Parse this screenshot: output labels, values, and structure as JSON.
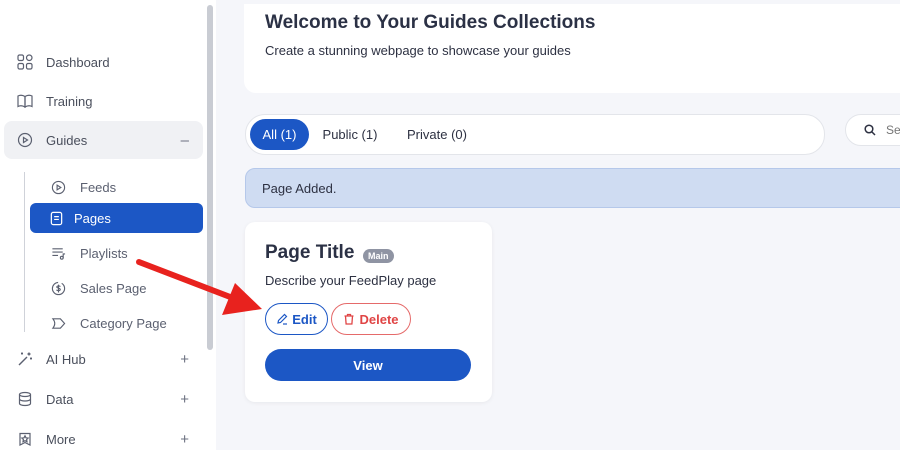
{
  "sidebar": {
    "items": [
      {
        "label": "Dashboard",
        "icon": "grid-icon"
      },
      {
        "label": "Training",
        "icon": "book-open-icon"
      },
      {
        "label": "Guides",
        "icon": "play-circle-icon",
        "toggle": "–"
      },
      {
        "label": "AI Hub",
        "icon": "magic-wand-icon",
        "toggle": "+"
      },
      {
        "label": "Data",
        "icon": "database-icon",
        "toggle": "+"
      },
      {
        "label": "More",
        "icon": "star-box-icon",
        "toggle": "+"
      }
    ],
    "sub_items": [
      {
        "label": "Feeds",
        "icon": "play-circle-icon"
      },
      {
        "label": "Pages",
        "icon": "document-icon",
        "selected": true
      },
      {
        "label": "Playlists",
        "icon": "playlist-icon"
      },
      {
        "label": "Sales Page",
        "icon": "dollar-icon"
      },
      {
        "label": "Category Page",
        "icon": "tag-icon"
      }
    ]
  },
  "header": {
    "title": "Welcome to Your Guides Collections",
    "subtitle": "Create a stunning webpage to showcase your guides"
  },
  "filters": {
    "tabs": [
      {
        "label": "All (1)",
        "active": true
      },
      {
        "label": "Public (1)",
        "active": false
      },
      {
        "label": "Private (0)",
        "active": false
      }
    ]
  },
  "search": {
    "placeholder": "Se"
  },
  "alert": {
    "message": "Page Added."
  },
  "page_card": {
    "title": "Page Title",
    "badge": "Main",
    "description": "Describe your FeedPlay page",
    "edit_label": "Edit",
    "delete_label": "Delete",
    "view_label": "View"
  },
  "colors": {
    "accent": "#1c57c5",
    "danger": "#e04545",
    "alert_bg": "#cfdcf2",
    "annotation_arrow": "#e8221e"
  }
}
